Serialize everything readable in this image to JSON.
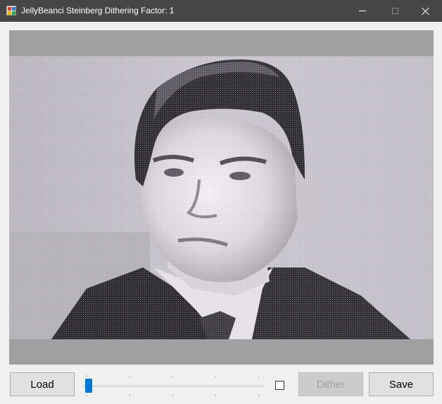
{
  "window": {
    "title": "JellyBeanci Steinberg Dithering Factor: 1",
    "icon": "app-icon",
    "controls": [
      "minimize-icon",
      "maximize-icon",
      "close-icon"
    ]
  },
  "picture": {
    "background": "#a0a0a0",
    "content": "dithered black-and-white portrait photo"
  },
  "controls": {
    "load_label": "Load",
    "dither_label": "Dither",
    "dither_enabled": false,
    "save_label": "Save",
    "factor_slider": {
      "value": 1,
      "min": 1,
      "max": 9
    },
    "checkbox_checked": false
  },
  "colors": {
    "titlebar": "#464646",
    "window_bg": "#f0f0f0",
    "slider_thumb": "#0078d7"
  }
}
